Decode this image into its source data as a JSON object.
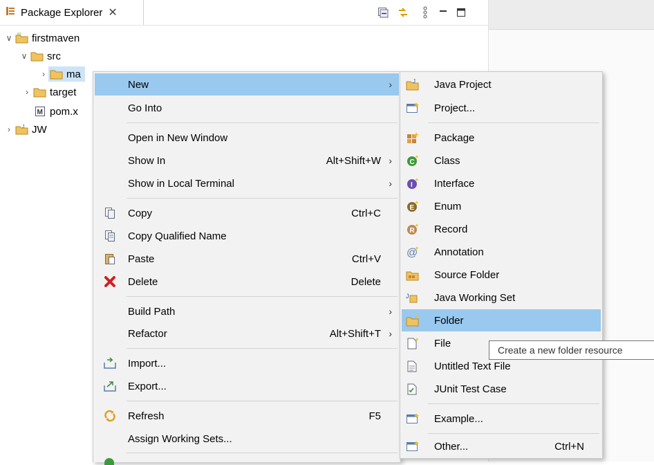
{
  "view": {
    "title": "Package Explorer",
    "toolbar_icons": [
      "collapse-all-icon",
      "link-with-editor-icon",
      "view-menu-icon",
      "minimize-icon",
      "maximize-icon"
    ]
  },
  "tree": {
    "items": [
      {
        "label": "firstmaven",
        "icon": "maven-project-icon",
        "expanded": true
      },
      {
        "label": "src",
        "icon": "folder-icon",
        "expanded": true
      },
      {
        "label": "ma",
        "icon": "folder-icon",
        "expanded": false,
        "selected": true
      },
      {
        "label": "target",
        "icon": "folder-icon",
        "expanded": false
      },
      {
        "label": "pom.x",
        "icon": "maven-pom-icon"
      },
      {
        "label": "JW",
        "icon": "java-project-icon",
        "expanded": false
      }
    ]
  },
  "context_menu": {
    "items": [
      {
        "label": "New",
        "submenu": true
      },
      {
        "label": "Go Into"
      },
      {
        "label": "Open in New Window"
      },
      {
        "label": "Show In",
        "accel": "Alt+Shift+W",
        "submenu": true
      },
      {
        "label": "Show in Local Terminal",
        "submenu": true
      },
      {
        "label": "Copy",
        "accel": "Ctrl+C",
        "icon": "copy-icon"
      },
      {
        "label": "Copy Qualified Name",
        "icon": "copy-qualified-name-icon"
      },
      {
        "label": "Paste",
        "accel": "Ctrl+V",
        "icon": "paste-icon"
      },
      {
        "label": "Delete",
        "accel": "Delete",
        "icon": "delete-icon"
      },
      {
        "label": "Build Path",
        "submenu": true
      },
      {
        "label": "Refactor",
        "accel": "Alt+Shift+T",
        "submenu": true
      },
      {
        "label": "Import...",
        "icon": "import-icon"
      },
      {
        "label": "Export...",
        "icon": "export-icon"
      },
      {
        "label": "Refresh",
        "accel": "F5",
        "icon": "refresh-icon"
      },
      {
        "label": "Assign Working Sets..."
      }
    ]
  },
  "submenu": {
    "items": [
      {
        "label": "Java Project",
        "icon": "java-project-icon"
      },
      {
        "label": "Project...",
        "icon": "project-icon"
      },
      {
        "label": "Package",
        "icon": "package-icon"
      },
      {
        "label": "Class",
        "icon": "class-icon"
      },
      {
        "label": "Interface",
        "icon": "interface-icon"
      },
      {
        "label": "Enum",
        "icon": "enum-icon"
      },
      {
        "label": "Record",
        "icon": "record-icon"
      },
      {
        "label": "Annotation",
        "icon": "annotation-icon"
      },
      {
        "label": "Source Folder",
        "icon": "source-folder-icon"
      },
      {
        "label": "Java Working Set",
        "icon": "java-working-set-icon"
      },
      {
        "label": "Folder",
        "icon": "folder-icon"
      },
      {
        "label": "File",
        "icon": "file-icon"
      },
      {
        "label": "Untitled Text File",
        "icon": "untitled-text-file-icon"
      },
      {
        "label": "JUnit Test Case",
        "icon": "junit-test-case-icon"
      },
      {
        "label": "Example...",
        "icon": "example-icon"
      },
      {
        "label": "Other...",
        "accel": "Ctrl+N",
        "icon": "other-icon"
      }
    ]
  },
  "tooltip": {
    "text": "Create a new folder resource"
  },
  "colors": {
    "highlight": "#99c9ef",
    "menu_bg": "#f2f2f2",
    "folder": "#e8b84a",
    "class_green": "#3a9a3a",
    "interface_purple": "#6a4fb0",
    "enum_brown": "#8a6a2a",
    "delete_red": "#d02020"
  }
}
